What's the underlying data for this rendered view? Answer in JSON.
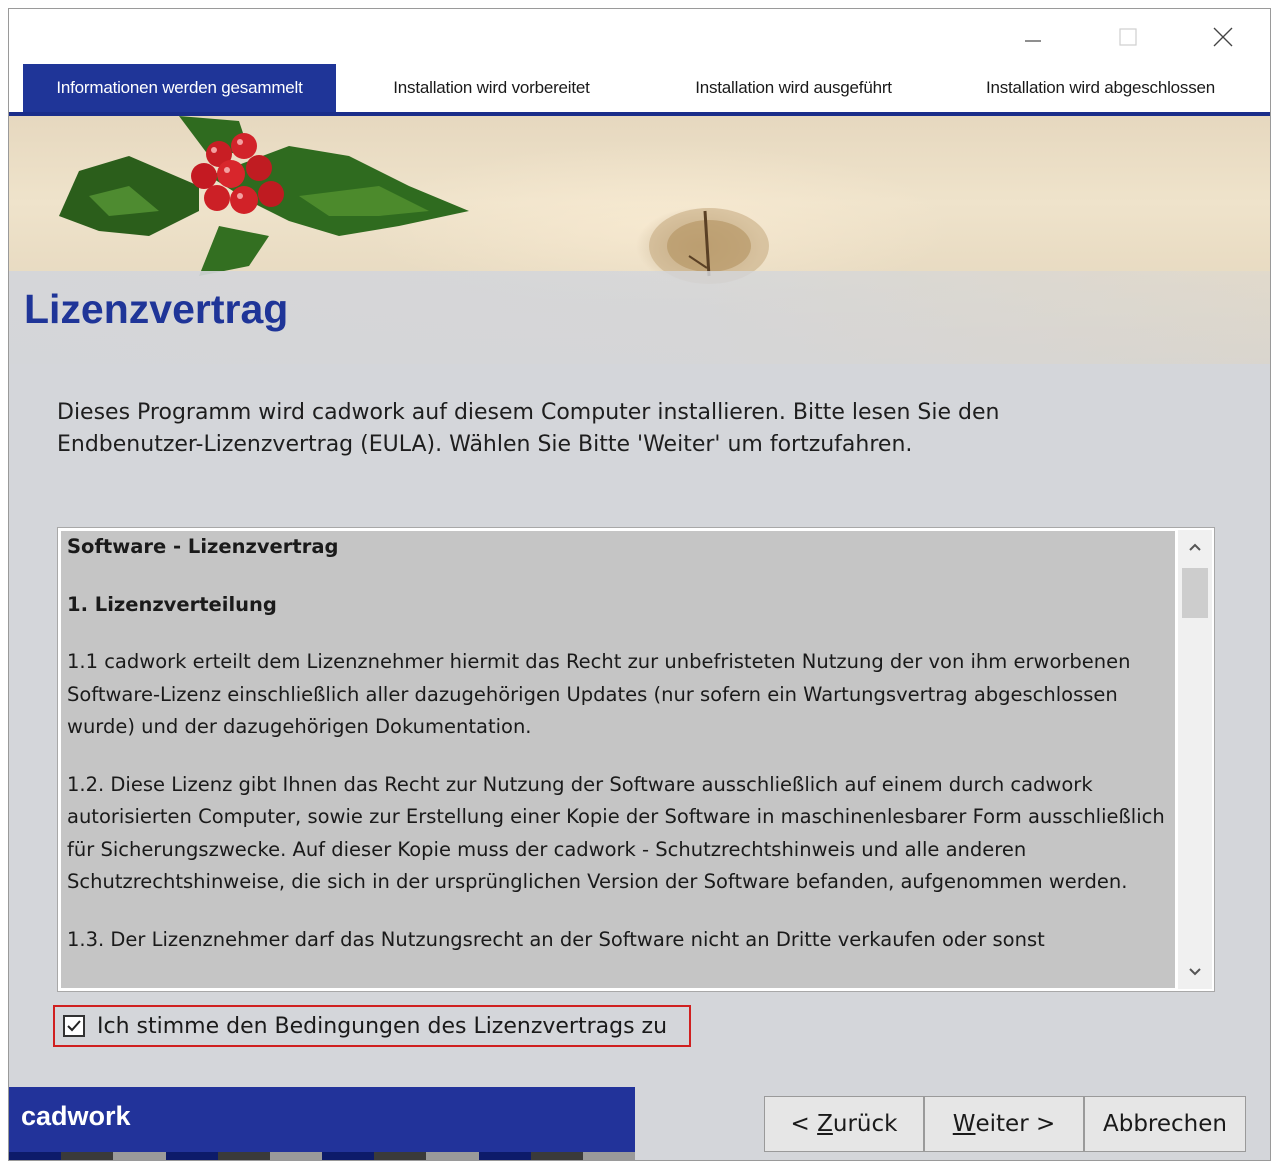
{
  "window": {
    "controls": [
      "minimize",
      "maximize",
      "close"
    ]
  },
  "steps": [
    {
      "label": "Informationen werden gesammelt",
      "active": true
    },
    {
      "label": "Installation wird vorbereitet",
      "active": false
    },
    {
      "label": "Installation wird ausgeführt",
      "active": false
    },
    {
      "label": "Installation wird abgeschlossen",
      "active": false
    }
  ],
  "page": {
    "title": "Lizenzvertrag",
    "intro_line1": "Dieses Programm wird cadwork auf diesem Computer installieren. Bitte lesen Sie den",
    "intro_line2": "Endbenutzer-Lizenzvertrag (EULA). Wählen Sie Bitte 'Weiter' um fortzufahren."
  },
  "eula": {
    "heading": "Software - Lizenzvertrag",
    "section1": "1.  Lizenzverteilung",
    "p1_1": "1.1   cadwork erteilt dem Lizenznehmer hiermit das Recht zur unbefristeten Nutzung der von ihm erworbenen Software-Lizenz einschließlich aller dazugehörigen Updates (nur sofern ein Wartungsvertrag abgeschlossen wurde) und der dazugehörigen Dokumentation.",
    "p1_2": "1.2.  Diese Lizenz gibt Ihnen das Recht zur Nutzung der Software ausschließlich auf einem durch cadwork autorisierten Computer, sowie zur Erstellung einer Kopie der Software in maschinenlesbarer Form ausschließlich für Sicherungszwecke. Auf dieser Kopie muss der cadwork - Schutzrechtshinweis und alle anderen Schutzrechtshinweise, die sich in der ursprünglichen Version der Software befanden, aufgenommen werden.",
    "p1_3": "1.3.  Der Lizenznehmer darf das Nutzungsrecht an der Software nicht an Dritte verkaufen oder sonst"
  },
  "agreement": {
    "label": "Ich stimme den Bedingungen des Lizenzvertrags zu",
    "checked": true
  },
  "brand": {
    "name": "cadwork"
  },
  "buttons": {
    "back_prefix": "< ",
    "back_mnemonic": "Z",
    "back_rest": "urück",
    "next_mnemonic": "W",
    "next_rest": "eiter >",
    "cancel": "Abbrechen"
  },
  "colors": {
    "accent": "#1f3598",
    "highlight_border": "#d02020"
  }
}
